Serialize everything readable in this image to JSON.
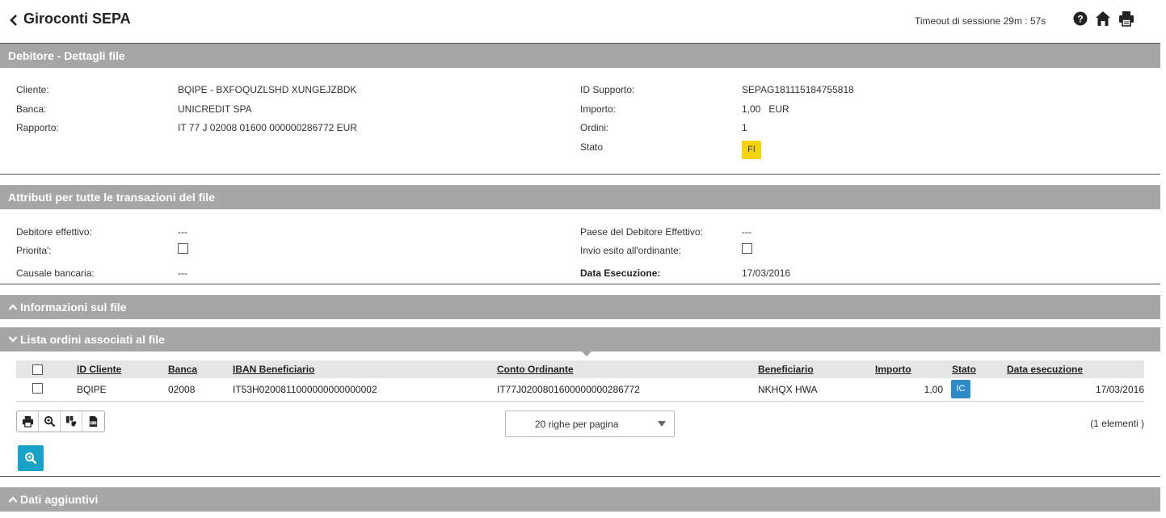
{
  "header": {
    "title": "Giroconti SEPA",
    "timeout": "Timeout di sessione 29m : 57s",
    "icons": [
      "back-icon",
      "help-icon",
      "home-icon",
      "print-icon"
    ]
  },
  "debitore": {
    "section_title": "Debitore - Dettagli file",
    "left": [
      {
        "label": "Cliente:",
        "value": "BQIPE - BXFOQUZLSHD XUNGEJZBDK"
      },
      {
        "label": "Banca:",
        "value": "UNICREDIT SPA"
      },
      {
        "label": "Rapporto:",
        "value": "IT 77 J 02008 01600 000000286772 EUR"
      }
    ],
    "right": [
      {
        "label": "ID Supporto:",
        "value": "SEPAG181115184755818"
      },
      {
        "label": "Importo:",
        "value": "1,00   EUR"
      },
      {
        "label": "Ordini:",
        "value": "1"
      },
      {
        "label": "Stato",
        "value": "FI"
      }
    ]
  },
  "attributi": {
    "section_title": "Attributi per tutte le transazioni del file",
    "debitore_effettivo_label": "Debitore effettivo:",
    "debitore_effettivo_value": "---",
    "priorita_label": "Priorita':",
    "causale_label": "Causale bancaria:",
    "causale_value": "---",
    "paese_label": "Paese del Debitore Effettivo:",
    "paese_value": "---",
    "invio_label": "Invio esito all'ordinante:",
    "data_label": "Data Esecuzione:",
    "data_value": "17/03/2016"
  },
  "informazioni": {
    "section_title": "Informazioni sul file"
  },
  "lista": {
    "section_title": "Lista ordini associati al file",
    "columns": [
      "ID Cliente",
      "Banca",
      "IBAN Beneficiario",
      "Conto Ordinante",
      "Beneficiario",
      "Importo",
      "Stato",
      "Data esecuzione"
    ],
    "rows": [
      {
        "id_cliente": "BQIPE",
        "banca": "02008",
        "iban": "IT53H0200811000000000000002",
        "conto": "IT77J0200801600000000286772",
        "beneficiario": "NKHQX HWA",
        "importo": "1,00",
        "stato": "IC",
        "data": "17/03/2016"
      }
    ],
    "page_size": "20 righe per pagina",
    "count": "(1 elementi )",
    "toolbar_icons": [
      "print-icon",
      "zoom-icon",
      "export-icon",
      "xls-icon"
    ]
  },
  "dati": {
    "section_title": "Dati aggiuntivi"
  },
  "colors": {
    "section_bar": "#a6a6a6",
    "badge_fi": "#f5d50a",
    "badge_ic": "#2f8bc8",
    "search_button": "#17a2c7"
  }
}
